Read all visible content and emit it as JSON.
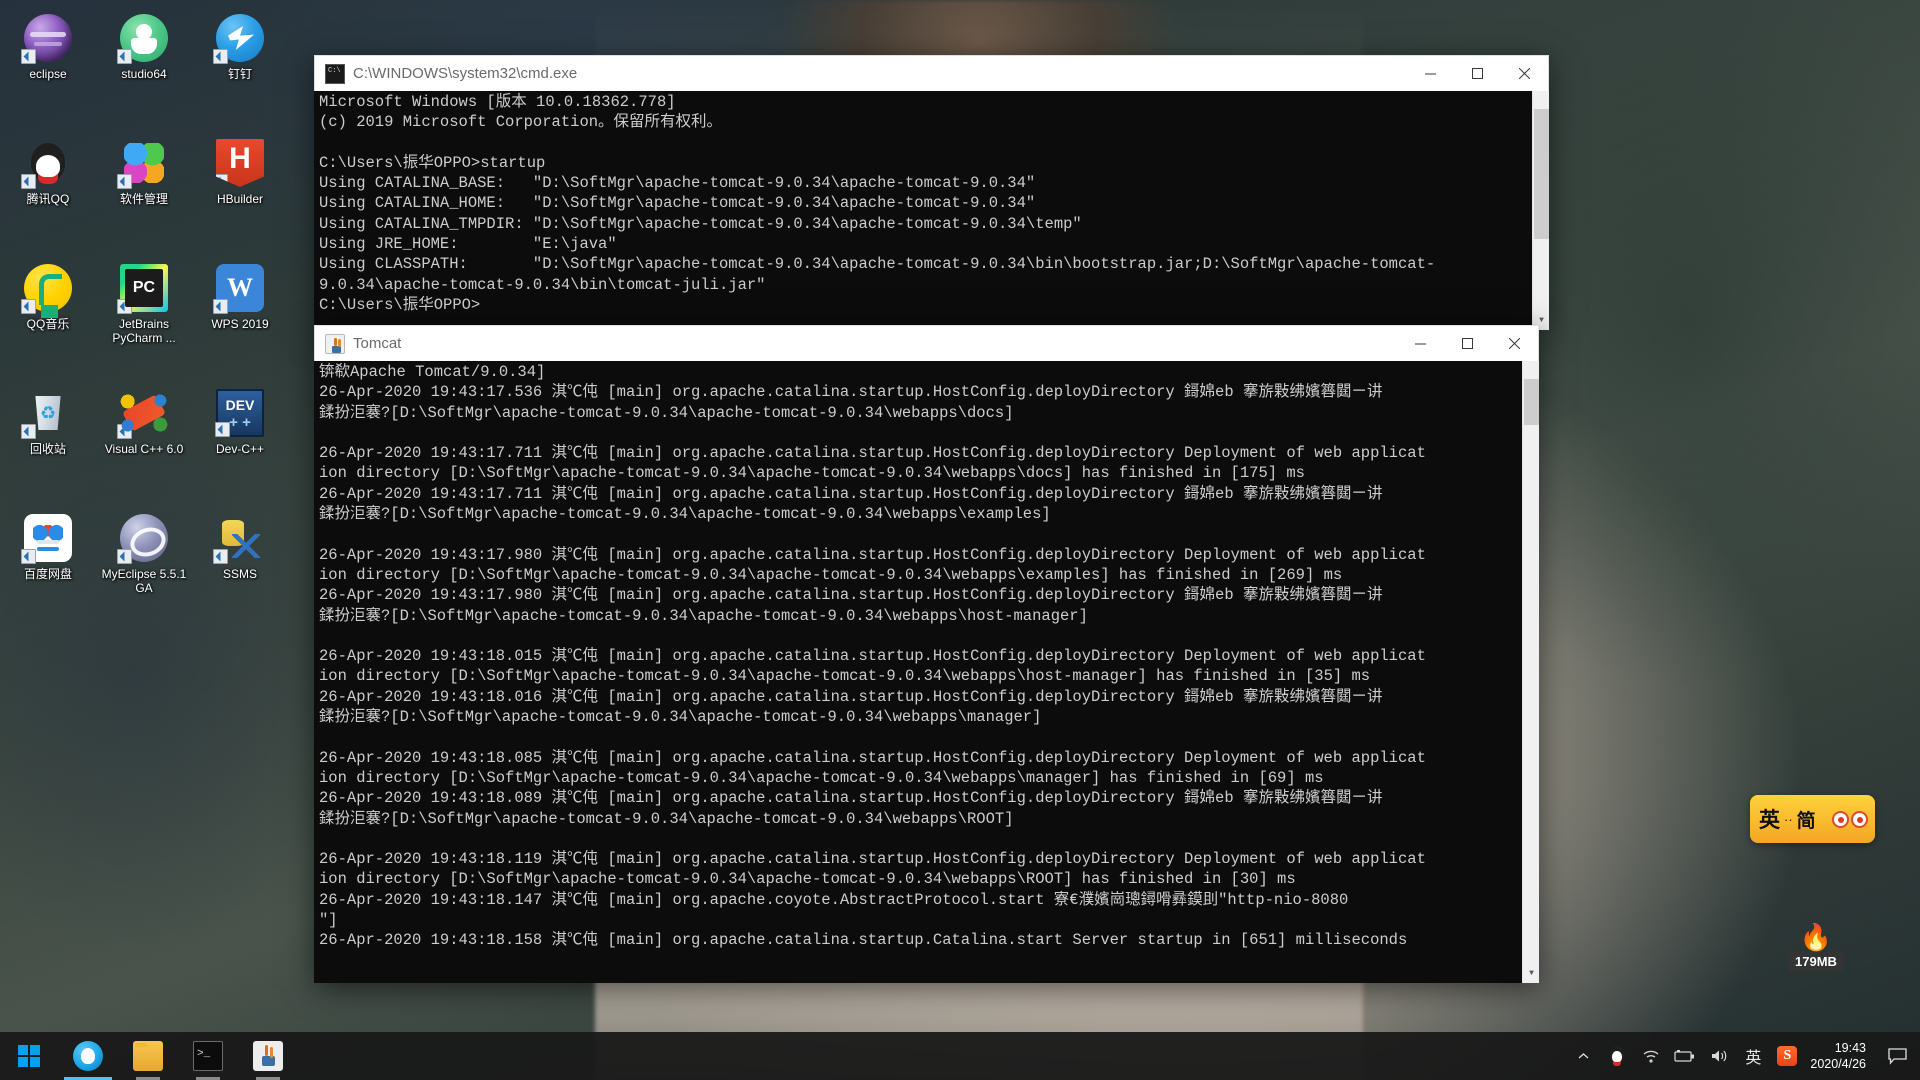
{
  "desktop": {
    "icons": [
      {
        "label": "eclipse",
        "art": "ico-eclipse",
        "name": "desktop-icon-eclipse"
      },
      {
        "label": "studio64",
        "art": "ico-studio",
        "name": "desktop-icon-studio64"
      },
      {
        "label": "钉钉",
        "art": "ico-dingtalk",
        "name": "desktop-icon-dingtalk"
      },
      {
        "label": "腾讯QQ",
        "art": "ico-qq",
        "name": "desktop-icon-tencent-qq"
      },
      {
        "label": "软件管理",
        "art": "ico-softmgr",
        "name": "desktop-icon-software-manager"
      },
      {
        "label": "HBuilder",
        "art": "ico-hbuilder",
        "name": "desktop-icon-hbuilder"
      },
      {
        "label": "QQ音乐",
        "art": "ico-qqmusic",
        "name": "desktop-icon-qq-music"
      },
      {
        "label": "JetBrains PyCharm ...",
        "art": "ico-pycharm",
        "name": "desktop-icon-pycharm"
      },
      {
        "label": "WPS 2019",
        "art": "ico-wps",
        "name": "desktop-icon-wps-2019"
      },
      {
        "label": "回收站",
        "art": "ico-recycle",
        "name": "desktop-icon-recycle-bin"
      },
      {
        "label": "Visual C++ 6.0",
        "art": "ico-vcpp",
        "name": "desktop-icon-visual-cpp-60"
      },
      {
        "label": "Dev-C++",
        "art": "ico-devcpp",
        "name": "desktop-icon-dev-cpp"
      },
      {
        "label": "百度网盘",
        "art": "ico-baidu",
        "name": "desktop-icon-baidu-netdisk"
      },
      {
        "label": "MyEclipse 5.5.1 GA",
        "art": "ico-myeclipse",
        "name": "desktop-icon-myeclipse"
      },
      {
        "label": "SSMS",
        "art": "ico-ssms",
        "name": "desktop-icon-ssms"
      }
    ]
  },
  "cmd_window": {
    "title": "C:\\WINDOWS\\system32\\cmd.exe",
    "icon": "cmd-icon",
    "minimize_label": "Minimize",
    "maximize_label": "Maximize",
    "close_label": "Close",
    "lines": [
      "Microsoft Windows [版本 10.0.18362.778]",
      "(c) 2019 Microsoft Corporation。保留所有权利。",
      "",
      "C:\\Users\\振华OPPO>startup",
      "Using CATALINA_BASE:   \"D:\\SoftMgr\\apache-tomcat-9.0.34\\apache-tomcat-9.0.34\"",
      "Using CATALINA_HOME:   \"D:\\SoftMgr\\apache-tomcat-9.0.34\\apache-tomcat-9.0.34\"",
      "Using CATALINA_TMPDIR: \"D:\\SoftMgr\\apache-tomcat-9.0.34\\apache-tomcat-9.0.34\\temp\"",
      "Using JRE_HOME:        \"E:\\java\"",
      "Using CLASSPATH:       \"D:\\SoftMgr\\apache-tomcat-9.0.34\\apache-tomcat-9.0.34\\bin\\bootstrap.jar;D:\\SoftMgr\\apache-tomcat-",
      "9.0.34\\apache-tomcat-9.0.34\\bin\\tomcat-juli.jar\"",
      "C:\\Users\\振华OPPO>"
    ]
  },
  "tomcat_window": {
    "title": "Tomcat",
    "icon": "java-icon",
    "minimize_label": "Minimize",
    "maximize_label": "Maximize",
    "close_label": "Close",
    "lines": [
      "锛欷Apache Tomcat/9.0.34]",
      "26-Apr-2020 19:43:17.536 淇℃伅 [main] org.apache.catalina.startup.HostConfig.deployDirectory 鎶婂eb 搴旂敤绋嬪簭閮ㄧ讲",
      "鍒扮洰褰?[D:\\SoftMgr\\apache-tomcat-9.0.34\\apache-tomcat-9.0.34\\webapps\\docs]",
      "",
      "26-Apr-2020 19:43:17.711 淇℃伅 [main] org.apache.catalina.startup.HostConfig.deployDirectory Deployment of web applicat",
      "ion directory [D:\\SoftMgr\\apache-tomcat-9.0.34\\apache-tomcat-9.0.34\\webapps\\docs] has finished in [175] ms",
      "26-Apr-2020 19:43:17.711 淇℃伅 [main] org.apache.catalina.startup.HostConfig.deployDirectory 鎶婂eb 搴旂敤绋嬪簭閮ㄧ讲",
      "鍒扮洰褰?[D:\\SoftMgr\\apache-tomcat-9.0.34\\apache-tomcat-9.0.34\\webapps\\examples]",
      "",
      "26-Apr-2020 19:43:17.980 淇℃伅 [main] org.apache.catalina.startup.HostConfig.deployDirectory Deployment of web applicat",
      "ion directory [D:\\SoftMgr\\apache-tomcat-9.0.34\\apache-tomcat-9.0.34\\webapps\\examples] has finished in [269] ms",
      "26-Apr-2020 19:43:17.980 淇℃伅 [main] org.apache.catalina.startup.HostConfig.deployDirectory 鎶婂eb 搴旂敤绋嬪簭閮ㄧ讲",
      "鍒扮洰褰?[D:\\SoftMgr\\apache-tomcat-9.0.34\\apache-tomcat-9.0.34\\webapps\\host-manager]",
      "",
      "26-Apr-2020 19:43:18.015 淇℃伅 [main] org.apache.catalina.startup.HostConfig.deployDirectory Deployment of web applicat",
      "ion directory [D:\\SoftMgr\\apache-tomcat-9.0.34\\apache-tomcat-9.0.34\\webapps\\host-manager] has finished in [35] ms",
      "26-Apr-2020 19:43:18.016 淇℃伅 [main] org.apache.catalina.startup.HostConfig.deployDirectory 鎶婂eb 搴旂敤绋嬪簭閮ㄧ讲",
      "鍒扮洰褰?[D:\\SoftMgr\\apache-tomcat-9.0.34\\apache-tomcat-9.0.34\\webapps\\manager]",
      "",
      "26-Apr-2020 19:43:18.085 淇℃伅 [main] org.apache.catalina.startup.HostConfig.deployDirectory Deployment of web applicat",
      "ion directory [D:\\SoftMgr\\apache-tomcat-9.0.34\\apache-tomcat-9.0.34\\webapps\\manager] has finished in [69] ms",
      "26-Apr-2020 19:43:18.089 淇℃伅 [main] org.apache.catalina.startup.HostConfig.deployDirectory 鎶婂eb 搴旂敤绋嬪簭閮ㄧ讲",
      "鍒扮洰褰?[D:\\SoftMgr\\apache-tomcat-9.0.34\\apache-tomcat-9.0.34\\webapps\\ROOT]",
      "",
      "26-Apr-2020 19:43:18.119 淇℃伅 [main] org.apache.catalina.startup.HostConfig.deployDirectory Deployment of web applicat",
      "ion directory [D:\\SoftMgr\\apache-tomcat-9.0.34\\apache-tomcat-9.0.34\\webapps\\ROOT] has finished in [30] ms",
      "26-Apr-2020 19:43:18.147 淇℃伅 [main] org.apache.coyote.AbstractProtocol.start 寮€濮嬪崗璁鐞嗗彞鏌刞\"http-nio-8080",
      "\"]",
      "26-Apr-2020 19:43:18.158 淇℃伅 [main] org.apache.catalina.startup.Catalina.start Server startup in [651] milliseconds"
    ]
  },
  "ime_widget": {
    "mode_label": "英",
    "dots": "··",
    "toggle_label": "简"
  },
  "memory_widget": {
    "flame": "🔥",
    "value": "179MB"
  },
  "taskbar": {
    "start_label": "Start",
    "items": [
      {
        "name": "taskbar-qq",
        "art": "tb-qq",
        "state": "active"
      },
      {
        "name": "taskbar-file-explorer",
        "art": "tb-explorer",
        "state": "running"
      },
      {
        "name": "taskbar-cmd",
        "art": "tb-cmd",
        "state": "running"
      },
      {
        "name": "taskbar-tomcat-java",
        "art": "tb-java",
        "state": "running"
      }
    ],
    "tray": {
      "show_hidden_label": "^",
      "qq_label": "QQ",
      "network_label": "Network",
      "battery_label": "Battery",
      "volume_label": "Volume",
      "ime_label": "英",
      "sogou_label": "S"
    },
    "clock": {
      "time": "19:43",
      "date": "2020/4/26"
    },
    "notification_label": "Notifications"
  }
}
